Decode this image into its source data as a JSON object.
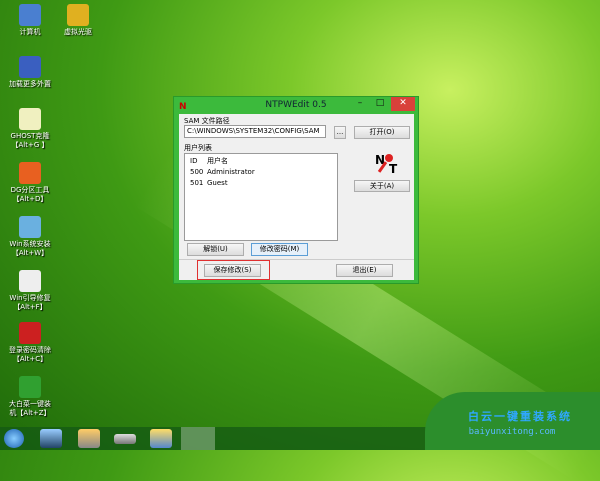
{
  "desktop": {
    "icons": [
      {
        "label": "计算机",
        "icon": "computer-icon",
        "color": "#4a7fd0"
      },
      {
        "label": "虚拟光驱",
        "icon": "disc-icon",
        "color": "#e0b020"
      },
      {
        "label": "加载更多外置",
        "icon": "network-icon",
        "color": "#3a5fc0"
      },
      {
        "label": "GHOST克隆",
        "sub": "【Alt+G 】",
        "icon": "ghost-icon",
        "color": "#f0f0c0"
      },
      {
        "label": "DG分区工具",
        "sub": "【Alt+D】",
        "icon": "partition-icon",
        "color": "#e86020"
      },
      {
        "label": "Win系统安装",
        "sub": "【Alt+W】",
        "icon": "install-icon",
        "color": "#6ab0e0"
      },
      {
        "label": "Win引导修复",
        "sub": "【Alt+F】",
        "icon": "repair-kit-icon",
        "color": "#eeeeee"
      },
      {
        "label": "登录密码清除",
        "sub": "【Alt+C】",
        "icon": "ntpwedit-icon",
        "color": "#cc2020"
      },
      {
        "label": "大白菜一键装",
        "sub": "机【Alt+Z】",
        "icon": "cabbage-icon",
        "color": "#30a030"
      }
    ]
  },
  "window": {
    "title": "NTPWEdit 0.5",
    "minimize": "–",
    "maximize": "□",
    "close": "✕",
    "sam_label": "SAM 文件路径",
    "sam_path": "C:\\WINDOWS\\SYSTEM32\\CONFIG\\SAM",
    "browse": "...",
    "open": "打开(O)",
    "user_list_label": "用户列表",
    "columns": [
      "ID",
      "用户名"
    ],
    "users": [
      {
        "id": "500",
        "name": "Administrator"
      },
      {
        "id": "501",
        "name": "Guest"
      }
    ],
    "about": "关于(A)",
    "unlock": "解锁(U)",
    "change_password": "修改密码(M)",
    "save": "保存修改(S)",
    "exit": "退出(E)",
    "logo_n": "N",
    "logo_t": "T"
  },
  "taskbar": {
    "items": [
      "start-orb-icon",
      "desktop-icon",
      "cleanup-icon",
      "drive-icon",
      "tools-icon",
      "ntpwedit-icon"
    ]
  },
  "watermark": {
    "line1": "白云一键重装系统",
    "line2": "baiyunxitong.com"
  },
  "colors": {
    "accent": "#3cba3c",
    "highlight": "#e03030"
  }
}
